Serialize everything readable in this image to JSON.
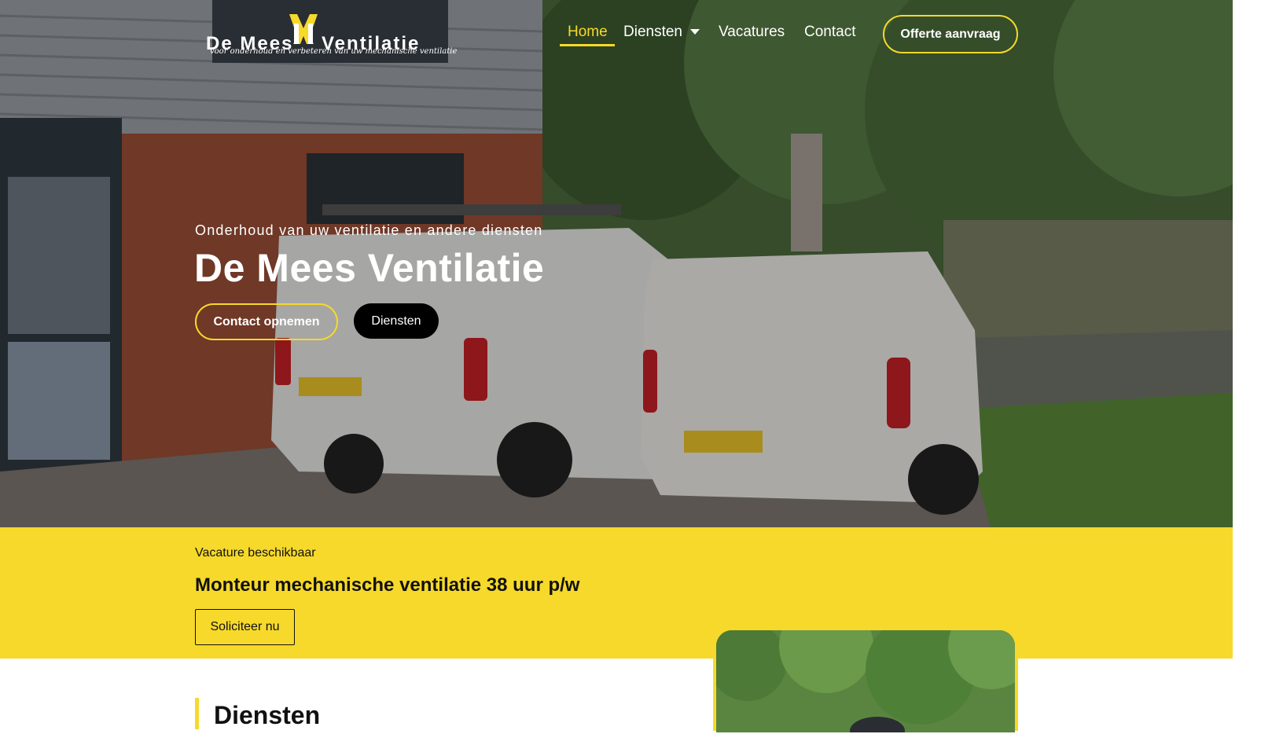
{
  "header": {
    "logo": {
      "word_left": "De Mees",
      "word_right": "Ventilatie",
      "tagline": "voor onderhoud en verbeteren van uw mechanische ventilatie",
      "mark": "M"
    },
    "nav": [
      {
        "label": "Home",
        "active": true
      },
      {
        "label": "Diensten",
        "has_dropdown": true
      },
      {
        "label": "Vacatures"
      },
      {
        "label": "Contact"
      }
    ],
    "cta_label": "Offerte aanvraag"
  },
  "hero": {
    "subtitle": "Onderhoud van uw ventilatie en andere diensten",
    "title": "De Mees Ventilatie",
    "primary_button": "Contact opnemen",
    "secondary_button": "Diensten"
  },
  "vacancy": {
    "kicker": "Vacature beschikbaar",
    "title": "Monteur mechanische ventilatie 38 uur p/w",
    "button": "Soliciteer nu"
  },
  "services": {
    "title": "Diensten"
  },
  "colors": {
    "accent": "#f6d92a",
    "dark": "#111111",
    "black": "#000000",
    "white": "#ffffff"
  },
  "icons": {
    "nav_dropdown": "chevron-down-icon"
  }
}
